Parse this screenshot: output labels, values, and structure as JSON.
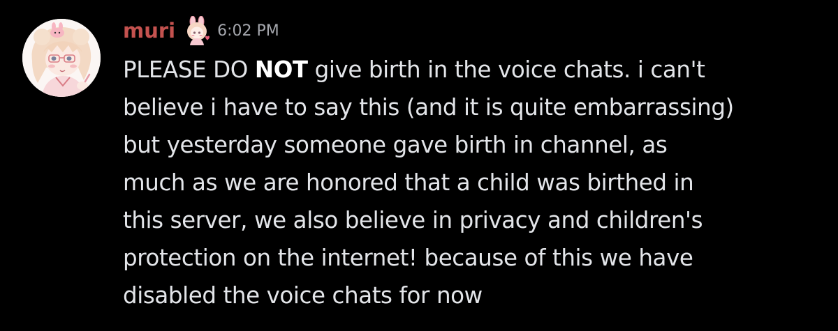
{
  "message": {
    "author": {
      "username": "muri",
      "username_color": "#c4524f",
      "avatar_icon": "anime-girl-avatar",
      "badge_icon": "bunny-girl-emoji-badge"
    },
    "timestamp": "6:02 PM",
    "content": {
      "line1_pre": "PLEASE DO ",
      "line1_bold": "NOT",
      "line1_post": " give birth in the voice chats. i can't",
      "lines": [
        "believe i have to say this (and it is quite embarrassing)",
        "but yesterday someone gave birth in channel, as",
        "much as we are honored that a child was birthed in",
        "this server, we also believe in privacy and children's",
        "protection on the internet! because of this we have",
        "disabled the voice chats for now"
      ]
    }
  }
}
